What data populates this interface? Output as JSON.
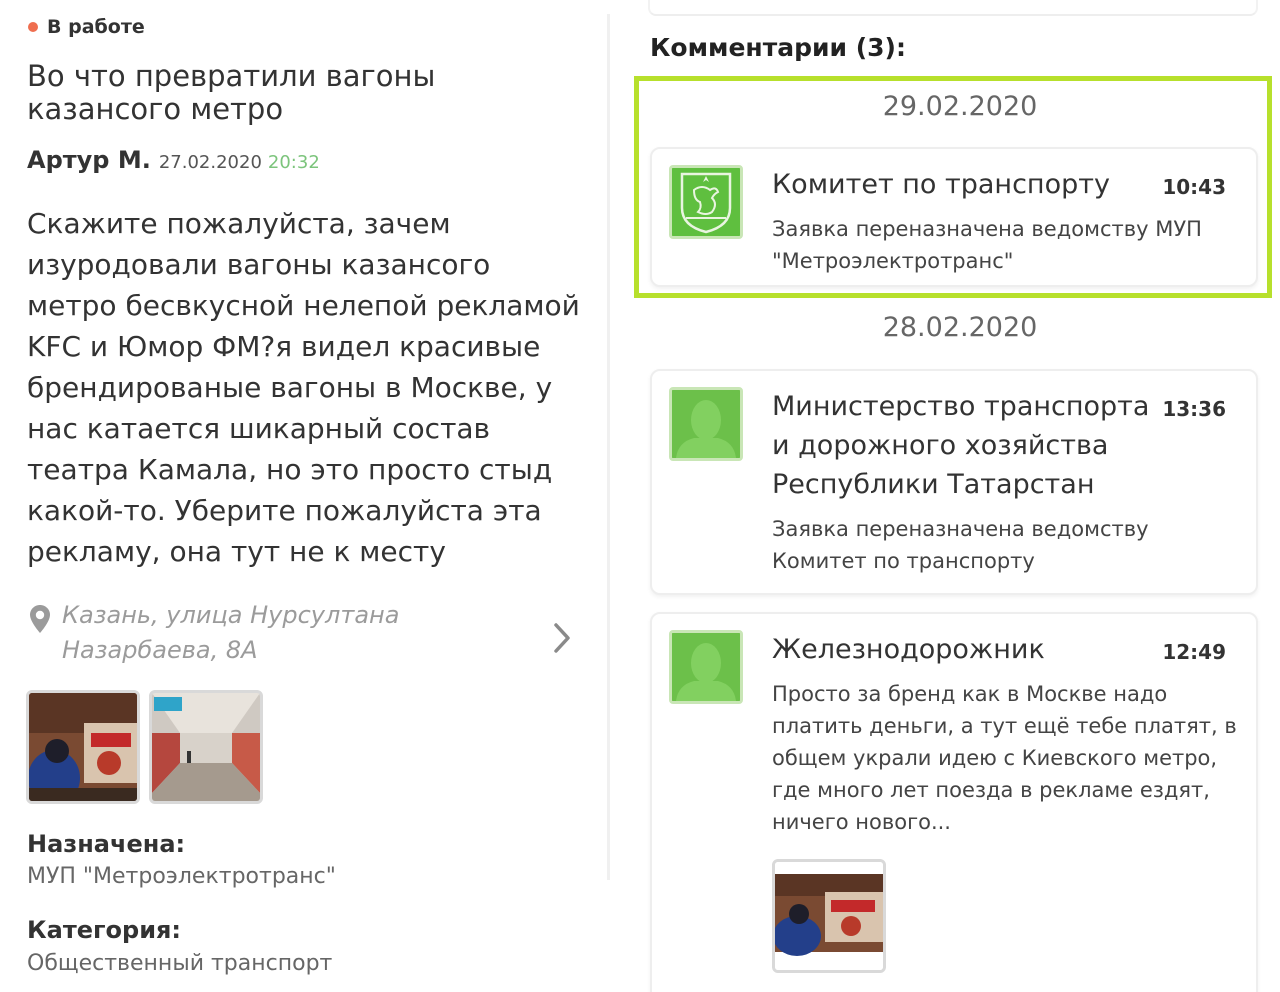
{
  "left": {
    "status": "В работе",
    "title": "Во что превратили вагоны казансого метро",
    "author": "Артур М.",
    "date": "27.02.2020",
    "time": "20:32",
    "body": "Скажите пожалуйста, зачем изуродовали вагоны казансого метро бесвкусной нелепой рекламой KFC и Юмор ФМ?я видел красивые брендированые вагоны в Москве, у нас катается шикарный состав театра Камала, но это просто стыд какой-то. Уберите пожалуйста эта рекламу, она тут не к месту",
    "location": "Казань, улица Нурсултана Назарбаева, 8А",
    "assigned_label": "Назначена:",
    "assigned_value": "МУП \"Метроэлектротранс\"",
    "category_label": "Категория:",
    "category_value": "Общественный транспорт"
  },
  "comments": {
    "title": "Комментарии (3):",
    "groups": [
      {
        "date": "29.02.2020",
        "items": [
          {
            "author": "Комитет по транспорту",
            "time": "10:43",
            "text": "Заявка переназначена ведомству МУП \"Метроэлектротранс\""
          }
        ]
      },
      {
        "date": "28.02.2020",
        "items": [
          {
            "author": "Министерство транспорта и дорожного хозяйства Республики Татарстан",
            "time": "13:36",
            "text": "Заявка переназначена ведомству Комитет по транспорту"
          },
          {
            "author": "Железнодорожник",
            "time": "12:49",
            "text": "Просто за бренд как в Москве надо платить деньги, а тут ещё тебе платят, в общем украли идею с Киевского метро, где много лет поезда в рекламе ездят, ничего нового..."
          }
        ]
      }
    ]
  },
  "colors": {
    "status_dot": "#ef6e4f",
    "highlight": "#b7e02c",
    "avatar_green": "#6cc04a",
    "time_green": "#7cc47c"
  }
}
